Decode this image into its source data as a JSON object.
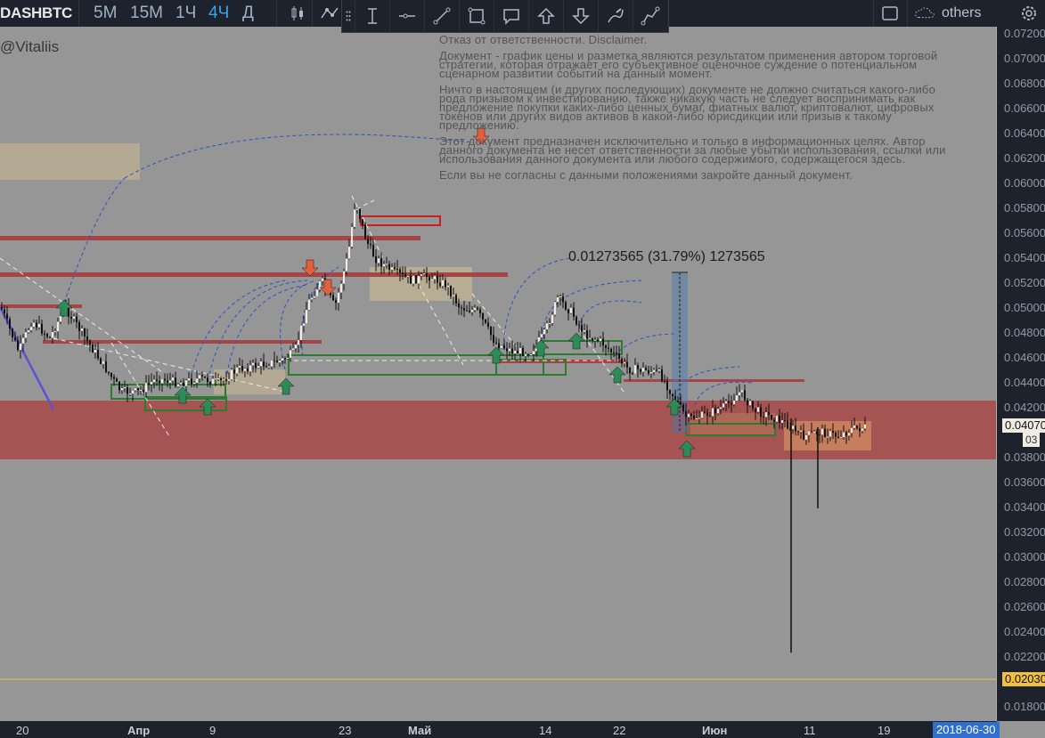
{
  "toolbar": {
    "symbol": "DASHBTC",
    "timeframes": [
      {
        "label": "5M",
        "active": false
      },
      {
        "label": "15M",
        "active": false
      },
      {
        "label": "1Ч",
        "active": false
      },
      {
        "label": "4Ч",
        "active": true
      },
      {
        "label": "Д",
        "active": false
      }
    ],
    "icons": [
      "candles-icon",
      "indicators-icon"
    ],
    "others_label": "others"
  },
  "drawing_tools": [
    "cross-line-icon",
    "horizontal-line-icon",
    "trend-line-icon",
    "rectangle-icon",
    "callout-icon",
    "arrow-up-icon",
    "arrow-down-icon",
    "pen-icon",
    "path-icon"
  ],
  "chart": {
    "watermark": "@Vitaliis",
    "measure_label": "0.01273565 (31.79%) 1273565",
    "disclaimer": [
      "Отказ от ответственности. Disclaimer.",
      "Документ - график цены и разметка являются результатом применения автором торговой стратегии, которая отражает его субъективное оценочное суждение о потенциальном сценарном развитии событий на данный момент.",
      "Ничто в настоящем (и других последующих) документе не должно считаться какого-либо рода призывом к инвестированию, также никакую часть не следует воспринимать как предложение покупки каких-либо ценных бумаг, фиатных валют, криптовалют, цифровых токенов или других видов активов в какой-либо юрисдикции или призыв к такому предложению.",
      "Этот документ предназначен исключительно и только в информационных целях. Автор данного документа не несет ответственности за любые убытки использования, ссылки или использования данного документа или любого содержимого, содержащегося здесь.",
      "Если вы не согласны с данными положениями закройте данный документ."
    ]
  },
  "price_axis": {
    "ticks": [
      "0.07200000",
      "0.07000000",
      "0.06800000",
      "0.06600000",
      "0.06400000",
      "0.06200000",
      "0.06000000",
      "0.05800000",
      "0.05600000",
      "0.05400000",
      "0.05200000",
      "0.05000000",
      "0.04800000",
      "0.04600000",
      "0.04400000",
      "0.04200000",
      "0.03800000",
      "0.03600000",
      "0.03400000",
      "0.03200000",
      "0.03000000",
      "0.02800000",
      "0.02600000",
      "0.02400000",
      "0.02200000",
      "0.01800000"
    ],
    "last_price": "0.04070000",
    "last_price_sub": "03",
    "hline_price": "0.02030000"
  },
  "time_axis": {
    "ticks": [
      {
        "label": "20",
        "bold": false
      },
      {
        "label": "Апр",
        "bold": true
      },
      {
        "label": "9",
        "bold": false
      },
      {
        "label": "23",
        "bold": false
      },
      {
        "label": "Май",
        "bold": true
      },
      {
        "label": "14",
        "bold": false
      },
      {
        "label": "22",
        "bold": false
      },
      {
        "label": "Июн",
        "bold": true
      },
      {
        "label": "11",
        "bold": false
      },
      {
        "label": "19",
        "bold": false
      }
    ],
    "cursor_date": "2018-06-30"
  },
  "colors": {
    "background": "#969696",
    "candle_up": "#f0ece4",
    "candle_down": "#111111",
    "red_zone": "#a84848",
    "green_box": "#2f7a2f",
    "arrow_up": "#2e8b57",
    "arrow_down": "#e2603e",
    "hline": "#f0c040",
    "accent": "#3ba4f0"
  }
}
